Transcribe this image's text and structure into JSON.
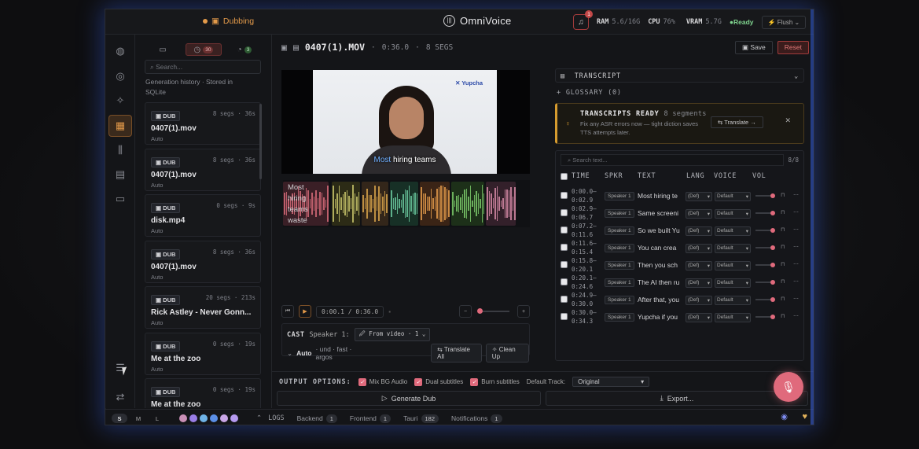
{
  "titlebar": {
    "dubbing": "Dubbing",
    "brand": "OmniVoice",
    "bell_count": "1",
    "ram_label": "RAM",
    "ram_value": "5.6/16G",
    "cpu_label": "CPU",
    "cpu_value": "76%",
    "vram_label": "VRAM",
    "vram_value": "5.7G",
    "status": "●Ready",
    "flush": "⚡ Flush ⌄"
  },
  "history": {
    "tab_history_badge": "30",
    "tab_other_badge": "3",
    "search_placeholder": "Search...",
    "note": "Generation history · Stored in SQLite",
    "items": [
      {
        "tag": "DUB",
        "meta": "8 segs · 36s",
        "name": "0407(1).mov",
        "sub": "Auto"
      },
      {
        "tag": "DUB",
        "meta": "8 segs · 36s",
        "name": "0407(1).mov",
        "sub": "Auto"
      },
      {
        "tag": "DUB",
        "meta": "0 segs · 9s",
        "name": "disk.mp4",
        "sub": "Auto"
      },
      {
        "tag": "DUB",
        "meta": "8 segs · 36s",
        "name": "0407(1).mov",
        "sub": "Auto"
      },
      {
        "tag": "DUB",
        "meta": "20 segs · 213s",
        "name": "Rick Astley - Never Gonn...",
        "sub": "Auto"
      },
      {
        "tag": "DUB",
        "meta": "0 segs · 19s",
        "name": "Me at the zoo",
        "sub": "Auto"
      },
      {
        "tag": "DUB",
        "meta": "0 segs · 19s",
        "name": "Me at the zoo",
        "sub": ""
      }
    ]
  },
  "editor": {
    "filename": "0407(1).MOV",
    "duration": "0:36.0",
    "segs": "8 SEGS",
    "save": "Save",
    "reset": "Reset",
    "video_logo": "Yupcha",
    "caption_highlight": "Most",
    "caption_rest": "hiring teams",
    "wave_label": "Most hiring teams waste",
    "timecode": "0:00.1 / 0:36.0",
    "cast_label": "CAST",
    "cast_speaker": "Speaker 1:",
    "cast_source": "From video · 1",
    "auto": "Auto",
    "auto_meta": "· und · fast · argos",
    "translate_all": "Translate All",
    "clean_up": "Clean Up"
  },
  "transcript": {
    "title": "TRANSCRIPT",
    "glossary": "+ GLOSSARY (0)",
    "ready_title": "TRANSCRIPTS READY",
    "ready_count": "8 segments",
    "ready_text": "Fix any ASR errors now — tight diction saves TTS attempts later.",
    "translate": "Translate →",
    "search_placeholder": "Search text...",
    "count": "8/8",
    "headers": [
      "TIME",
      "SPKR",
      "TEXT",
      "LANG",
      "VOICE",
      "VOL"
    ],
    "rows": [
      {
        "t1": "0:00.0–",
        "t2": "0:02.9",
        "spk": "Speaker 1",
        "text": "Most hiring te",
        "lang": "(Def)",
        "voice": "Default"
      },
      {
        "t1": "0:02.9–",
        "t2": "0:06.7",
        "spk": "Speaker 1",
        "text": "Same screeni",
        "lang": "(Def)",
        "voice": "Default"
      },
      {
        "t1": "0:07.2–",
        "t2": "0:11.6",
        "spk": "Speaker 1",
        "text": "So we built Yu",
        "lang": "(Def)",
        "voice": "Default"
      },
      {
        "t1": "0:11.6–",
        "t2": "0:15.4",
        "spk": "Speaker 1",
        "text": "You can crea",
        "lang": "(Def)",
        "voice": "Default"
      },
      {
        "t1": "0:15.8–",
        "t2": "0:20.1",
        "spk": "Speaker 1",
        "text": "Then you sch",
        "lang": "(Def)",
        "voice": "Default"
      },
      {
        "t1": "0:20.1–",
        "t2": "0:24.6",
        "spk": "Speaker 1",
        "text": "The AI then ru",
        "lang": "(Def)",
        "voice": "Default"
      },
      {
        "t1": "0:24.9–",
        "t2": "0:30.0",
        "spk": "Speaker 1",
        "text": "After that, you",
        "lang": "(Def)",
        "voice": "Default"
      },
      {
        "t1": "0:30.0–",
        "t2": "0:34.3",
        "spk": "Speaker 1",
        "text": "Yupcha if you",
        "lang": "(Def)",
        "voice": "Default"
      }
    ]
  },
  "output": {
    "label": "OUTPUT OPTIONS:",
    "mix": "Mix BG Audio",
    "dual": "Dual subtitles",
    "burn": "Burn subtitles",
    "default_track": "Default Track:",
    "track_value": "Original",
    "generate": "Generate Dub",
    "export": "Export..."
  },
  "statusbar": {
    "s": "S",
    "m": "M",
    "l": "L",
    "logs": "LOGS",
    "backend": "Backend",
    "backend_n": "1",
    "frontend": "Frontend",
    "frontend_n": "1",
    "tauri": "Tauri",
    "tauri_n": "182",
    "notifications": "Notifications",
    "notifications_n": "1"
  },
  "colors": {
    "accent_orange": "#e39a4a",
    "accent_pink": "#e06a7c",
    "ready_green": "#7fd38e",
    "reset_red": "#e27878",
    "theme_dots": [
      "#c98fb6",
      "#9a7ee6",
      "#6fb3e6",
      "#5b8fe6",
      "#c9a6e6",
      "#b69af0"
    ]
  }
}
